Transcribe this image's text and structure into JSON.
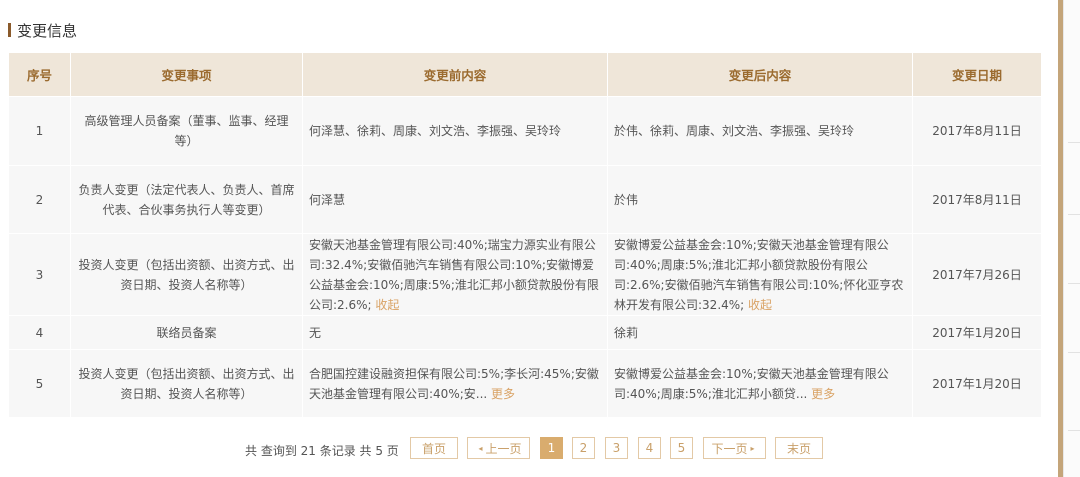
{
  "section": {
    "title": "变更信息"
  },
  "table": {
    "headers": [
      "序号",
      "变更事项",
      "变更前内容",
      "变更后内容",
      "变更日期"
    ],
    "rows": [
      {
        "index": "1",
        "item": "高级管理人员备案（董事、监事、经理等）",
        "before": "何泽慧、徐莉、周康、刘文浩、李振强、吴玲玲",
        "after": "於伟、徐莉、周康、刘文浩、李振强、吴玲玲",
        "date": "2017年8月11日"
      },
      {
        "index": "2",
        "item": "负责人变更（法定代表人、负责人、首席代表、合伙事务执行人等变更）",
        "before": "何泽慧",
        "after": "於伟",
        "date": "2017年8月11日"
      },
      {
        "index": "3",
        "item": "投资人变更（包括出资额、出资方式、出资日期、投资人名称等）",
        "before": "安徽天池基金管理有限公司:40%;瑞宝力源实业有限公司:32.4%;安徽佰驰汽车销售有限公司:10%;安徽博爱公益基金会:10%;周康:5%;淮北汇邦小额贷款股份有限公司:2.6%;",
        "before_link": "收起",
        "after": "安徽博爱公益基金会:10%;安徽天池基金管理有限公司:40%;周康:5%;淮北汇邦小额贷款股份有限公司:2.6%;安徽佰驰汽车销售有限公司:10%;怀化亚亨农林开发有限公司:32.4%;",
        "after_link": "收起",
        "date": "2017年7月26日"
      },
      {
        "index": "4",
        "item": "联络员备案",
        "before": "无",
        "after": "徐莉",
        "date": "2017年1月20日"
      },
      {
        "index": "5",
        "item": "投资人变更（包括出资额、出资方式、出资日期、投资人名称等）",
        "before": "合肥国控建设融资担保有限公司:5%;李长河:45%;安徽天池基金管理有限公司:40%;安...",
        "before_link": "更多",
        "after": "安徽博爱公益基金会:10%;安徽天池基金管理有限公司:40%;周康:5%;淮北汇邦小额贷...",
        "after_link": "更多",
        "date": "2017年1月20日"
      }
    ]
  },
  "pagination": {
    "total_text": "共 查询到 21 条记录 共 5 页",
    "first": "首页",
    "prev": "上一页",
    "pages": [
      "1",
      "2",
      "3",
      "4",
      "5"
    ],
    "current": "1",
    "next": "下一页",
    "last": "末页",
    "prev_icon": "triangle-left-icon",
    "next_icon": "triangle-right-icon"
  },
  "colors": {
    "header_bg": "#efe6d9",
    "header_text": "#9b6b2f",
    "accent": "#d9ac6e",
    "link": "#d9a264",
    "row_bg": "#f7f7f7",
    "rail": "#c4a57a"
  }
}
